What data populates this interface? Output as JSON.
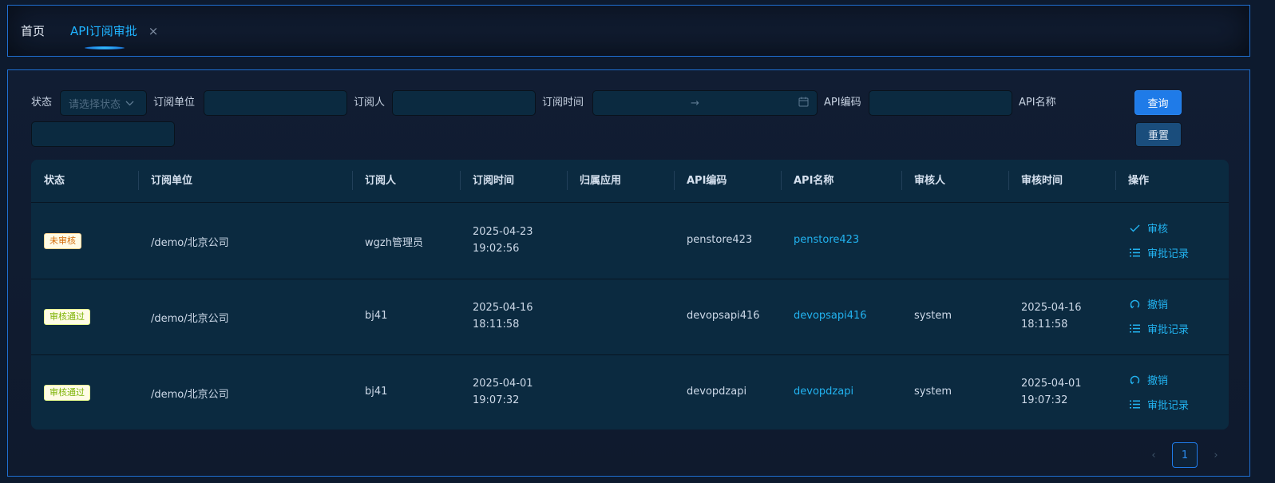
{
  "tabs": {
    "home": "首页",
    "active": "API订阅审批",
    "close_glyph": "×"
  },
  "filters": {
    "status_label": "状态",
    "status_placeholder": "请选择状态",
    "unit_label": "订阅单位",
    "unit_value": "",
    "subscriber_label": "订阅人",
    "subscriber_value": "",
    "time_label": "订阅时间",
    "time_separator": "→",
    "api_code_label": "API编码",
    "api_code_value": "",
    "api_name_label": "API名称",
    "api_name_value": "",
    "query_button": "查询",
    "reset_button": "重置"
  },
  "table": {
    "columns": [
      "状态",
      "订阅单位",
      "订阅人",
      "订阅时间",
      "归属应用",
      "API编码",
      "API名称",
      "审核人",
      "审核时间",
      "操作"
    ],
    "rows": [
      {
        "status": "未审核",
        "status_kind": "pending",
        "unit": "/demo/北京公司",
        "subscriber": "wgzh管理员",
        "sub_date": "2025-04-23",
        "sub_time": "19:02:56",
        "app": "",
        "api_code": "penstore423",
        "api_name": "penstore423",
        "reviewer": "",
        "review_date": "",
        "review_time": "",
        "action1": "审核",
        "action1_icon": "check-icon",
        "action2": "审批记录",
        "action2_icon": "list-icon"
      },
      {
        "status": "审核通过",
        "status_kind": "approved",
        "unit": "/demo/北京公司",
        "subscriber": "bj41",
        "sub_date": "2025-04-16",
        "sub_time": "18:11:58",
        "app": "",
        "api_code": "devopsapi416",
        "api_name": "devopsapi416",
        "reviewer": "system",
        "review_date": "2025-04-16",
        "review_time": "18:11:58",
        "action1": "撤销",
        "action1_icon": "undo-icon",
        "action2": "审批记录",
        "action2_icon": "list-icon"
      },
      {
        "status": "审核通过",
        "status_kind": "approved",
        "unit": "/demo/北京公司",
        "subscriber": "bj41",
        "sub_date": "2025-04-01",
        "sub_time": "19:07:32",
        "app": "",
        "api_code": "devopdzapi",
        "api_name": "devopdzapi",
        "reviewer": "system",
        "review_date": "2025-04-01",
        "review_time": "19:07:32",
        "action1": "撤销",
        "action1_icon": "undo-icon",
        "action2": "审批记录",
        "action2_icon": "list-icon"
      }
    ]
  },
  "pagination": {
    "current": "1",
    "prev_glyph": "‹",
    "next_glyph": "›"
  },
  "colors": {
    "accent": "#1fb3ff",
    "link": "#22b3f0",
    "primary_button": "#1f7be8",
    "frame_border": "#1f6fd1",
    "pending_text": "#d46b08",
    "approved_text": "#7cb305"
  }
}
